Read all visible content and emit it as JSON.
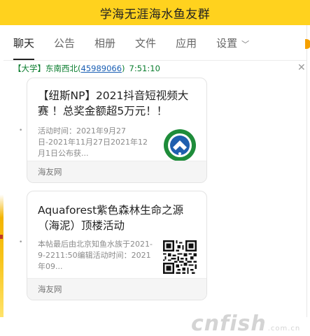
{
  "title_bar": {
    "title": "学海无涯海水鱼友群"
  },
  "tabs": [
    {
      "label": "聊天"
    },
    {
      "label": "公告"
    },
    {
      "label": "相册"
    },
    {
      "label": "文件"
    },
    {
      "label": "应用"
    },
    {
      "label": "设置"
    }
  ],
  "message": {
    "sender": "【大学】东南西北(",
    "qq": "45989066",
    "close_paren": ")",
    "time": "7:51:10"
  },
  "cards": [
    {
      "title": "【纽斯NP】2021抖音短视频大赛 ！总奖金额超5万元！！",
      "description": "活动时间：2021年9月27日-2021年11月27日2021年12月1日公布获...",
      "source": "海友网",
      "thumb_icon": "round-logo-icon"
    },
    {
      "title": "Aquaforest紫色森林生命之源（海泥）顶楼活动",
      "description": "本帖最后由北京知鱼水族于2021-9-2211:50编辑活动时间：2021年09...",
      "source": "海友网",
      "thumb_icon": "qr-code-icon"
    }
  ],
  "watermark": {
    "text": "cnfish",
    "sub": ".com.cn"
  },
  "colors": {
    "title_bar": "#ffd21e",
    "sender": "#0a7d2e",
    "link": "#1a5fb4"
  }
}
